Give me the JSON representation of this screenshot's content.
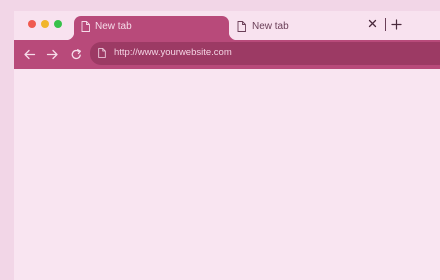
{
  "window": {
    "traffic_lights": [
      "close",
      "minimize",
      "maximize"
    ]
  },
  "tabs": [
    {
      "label": "New tab",
      "active": true,
      "icon": "page-icon"
    },
    {
      "label": "New tab",
      "active": false,
      "icon": "page-icon"
    }
  ],
  "tab_actions": {
    "close_icon": "close-icon",
    "new_tab_icon": "plus-icon"
  },
  "toolbar": {
    "back_icon": "arrow-left-icon",
    "forward_icon": "arrow-right-icon",
    "reload_icon": "reload-icon",
    "address": {
      "url": "http://www.yourwebsite.com",
      "icon": "page-icon"
    }
  },
  "colors": {
    "accent": "#b84a7a",
    "omnibox": "#9c3a64",
    "background": "#f2d6e7",
    "content": "#f9e5f1",
    "traffic_close": "#f05a4f",
    "traffic_minimize": "#f1b52b",
    "traffic_maximize": "#37c14a"
  }
}
